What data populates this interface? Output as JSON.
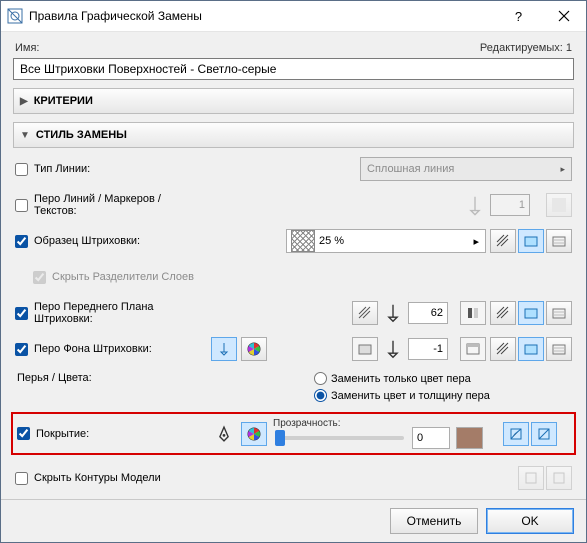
{
  "titlebar": {
    "title": "Правила Графической Замены"
  },
  "name": {
    "label": "Имя:",
    "editable_label": "Редактируемых: 1",
    "value": "Все Штриховки Поверхностей - Светло-серые"
  },
  "sections": {
    "criteria": "КРИТЕРИИ",
    "style": "СТИЛЬ ЗАМЕНЫ"
  },
  "rows": {
    "line_type": {
      "label": "Тип Линии:",
      "dropdown": "Сплошная линия"
    },
    "line_pen": {
      "label": "Перо Линий / Маркеров / Текстов:",
      "value": "1"
    },
    "fill": {
      "label": "Образец Штриховки:",
      "dropdown": "25 %"
    },
    "hide_sep": {
      "label": "Скрыть Разделители Слоев"
    },
    "fg_pen": {
      "label": "Перо Переднего Плана Штриховки:",
      "value": "62"
    },
    "bg_pen": {
      "label": "Перо Фона Штриховки:",
      "value": "-1"
    },
    "pens_hdr": {
      "label": "Перья / Цвета:"
    },
    "radio1": "Заменить только цвет пера",
    "radio2": "Заменить цвет и толщину пера",
    "surface": {
      "label": "Покрытие:",
      "opacity_label": "Прозрачность:",
      "opacity_value": "0",
      "swatch_color": "#a47c68"
    },
    "hide_contour": {
      "label": "Скрыть Контуры Модели"
    }
  },
  "footer": {
    "cancel": "Отменить",
    "ok": "OK"
  }
}
